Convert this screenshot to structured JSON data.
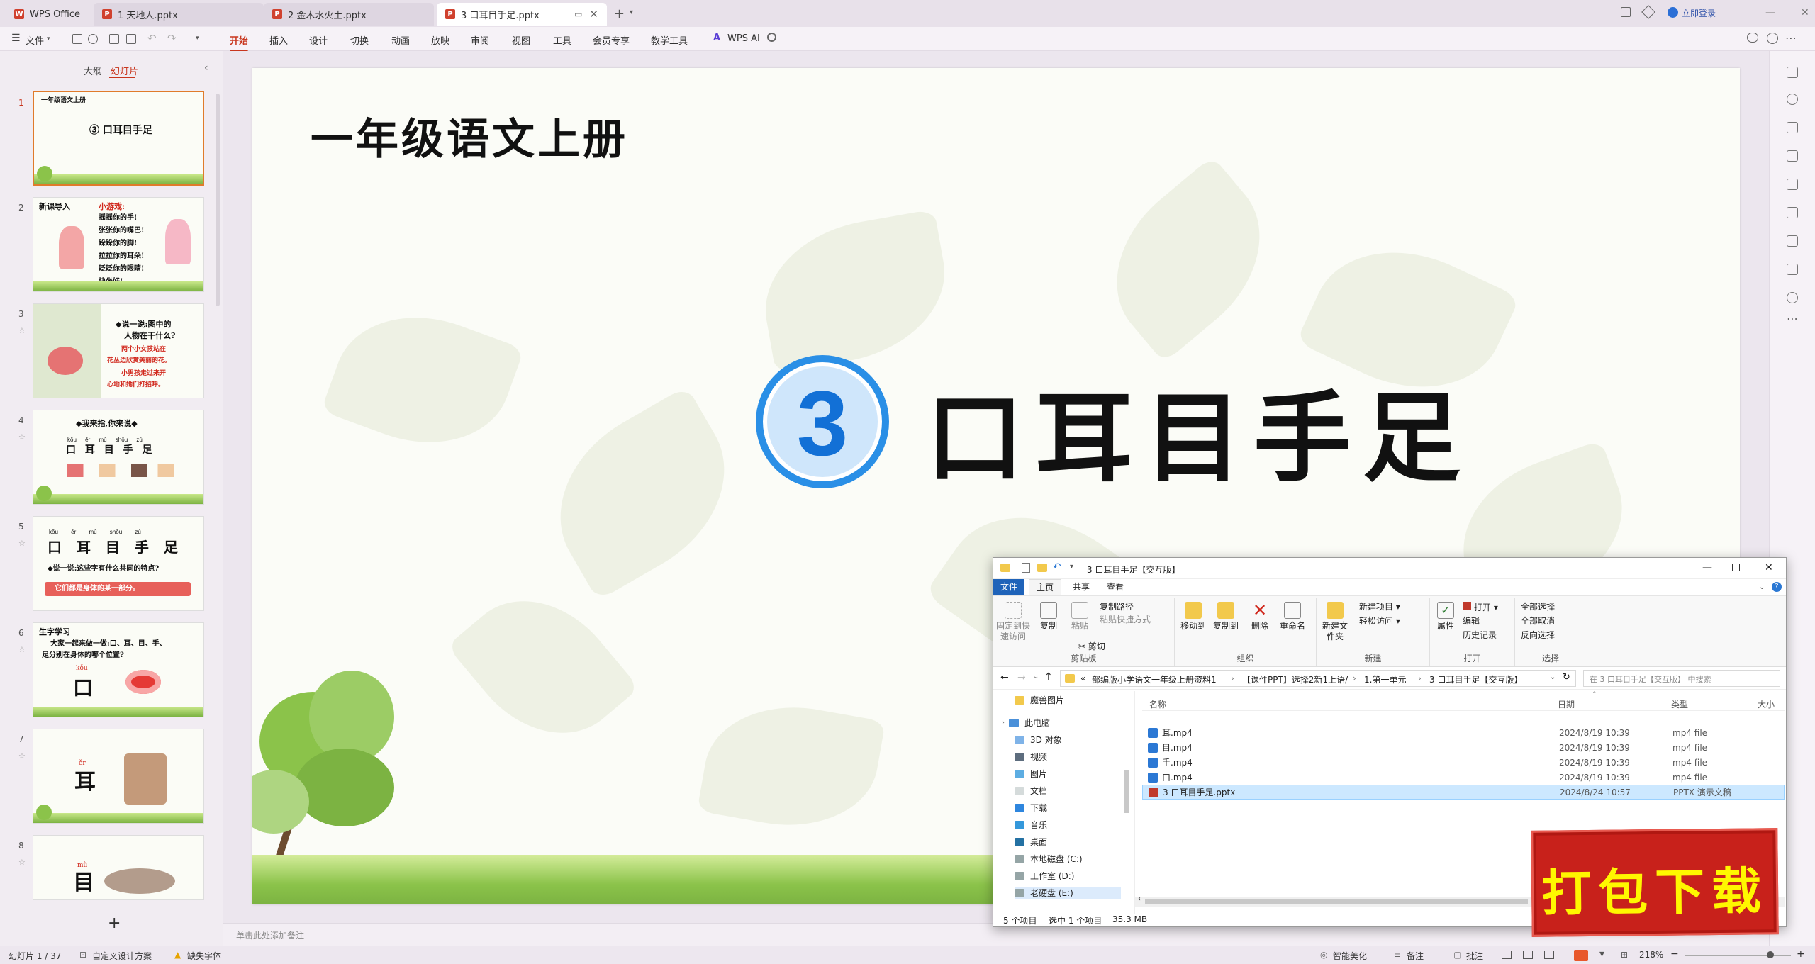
{
  "titlebar": {
    "app_tab": "WPS Office",
    "tabs": [
      {
        "label": "1 天地人.pptx"
      },
      {
        "label": "2 金木水火土.pptx"
      },
      {
        "label": "3 口耳目手足.pptx"
      }
    ],
    "login": "立即登录"
  },
  "ribbon": {
    "file": "文件",
    "tabs": [
      "开始",
      "插入",
      "设计",
      "切换",
      "动画",
      "放映",
      "审阅",
      "视图",
      "工具",
      "会员专享",
      "教学工具"
    ],
    "wps_ai": "WPS AI"
  },
  "left_panel": {
    "tab_outline": "大纲",
    "tab_slides": "幻灯片",
    "add": "+",
    "slides": [
      {
        "num": "1",
        "lines": [
          "一年级语文上册",
          "③ 口耳目手足"
        ]
      },
      {
        "num": "2",
        "lines": [
          "新课导入",
          "小游戏:",
          "摇摇你的手!",
          "张张你的嘴巴!",
          "跺跺你的脚!",
          "拉拉你的耳朵!",
          "眨眨你的眼睛!",
          "快坐好!"
        ]
      },
      {
        "num": "3",
        "lines": [
          "◆说一说:图中的",
          "人物在干什么?",
          "两个小女孩站在",
          "花丛边欣赏美丽的花。",
          "小男孩走过来开",
          "心地和她们打招呼。"
        ]
      },
      {
        "num": "4",
        "lines": [
          "◆我来指,你来说◆",
          "kǒu ěr mù shǒu zú",
          "口 耳 目 手 足"
        ]
      },
      {
        "num": "5",
        "lines": [
          "kǒu ěr mù shǒu zú",
          "口 耳 目 手 足",
          "◆说一说:这些字有什么共同的特点?",
          "它们都是身体的某一部分。"
        ]
      },
      {
        "num": "6",
        "lines": [
          "生字学习",
          "大家一起来做一做:口、耳、目、手、",
          "足分别在身体的哪个位置?",
          "kǒu",
          "口"
        ]
      },
      {
        "num": "7",
        "lines": [
          "ěr",
          "耳"
        ]
      },
      {
        "num": "8",
        "lines": [
          "mù",
          "目"
        ]
      }
    ]
  },
  "slide": {
    "title": "一年级语文上册",
    "lesson_number": "3",
    "lesson_name": "口耳目手足"
  },
  "notes_placeholder": "单击此处添加备注",
  "statusbar": {
    "slide_info": "幻灯片 1 / 37",
    "design": "自定义设计方案",
    "font": "缺失字体",
    "beautify": "智能美化",
    "notes": "备注",
    "comments": "批注",
    "zoom": "218%"
  },
  "explorer": {
    "title": "3 口耳目手足【交互版】",
    "ribbon_tabs": [
      "文件",
      "主页",
      "共享",
      "查看"
    ],
    "groups": [
      {
        "label": "剪贴板",
        "buttons": [
          "固定到快速访问",
          "复制",
          "粘贴",
          "复制路径",
          "粘贴快捷方式",
          "剪切"
        ]
      },
      {
        "label": "组织",
        "buttons": [
          "移动到",
          "复制到",
          "删除",
          "重命名"
        ]
      },
      {
        "label": "新建",
        "buttons": [
          "新建文件夹",
          "新建项目",
          "轻松访问"
        ]
      },
      {
        "label": "打开",
        "buttons": [
          "属性",
          "打开",
          "编辑",
          "历史记录"
        ]
      },
      {
        "label": "选择",
        "buttons": [
          "全部选择",
          "全部取消",
          "反向选择"
        ]
      }
    ],
    "breadcrumb": [
      "«",
      "部编版小学语文一年级上册资料1",
      "【课件PPT】选择2新1上语/",
      "1.第一单元",
      "3 口耳目手足【交互版】"
    ],
    "search_placeholder": "在 3 口耳目手足【交互版】 中搜索",
    "nav": [
      "魔兽图片",
      "此电脑",
      "3D 对象",
      "视频",
      "图片",
      "文档",
      "下载",
      "音乐",
      "桌面",
      "本地磁盘 (C:)",
      "工作室 (D:)",
      "老硬盘 (E:)"
    ],
    "columns": [
      "名称",
      "日期",
      "类型",
      "大小"
    ],
    "files": [
      {
        "name": "耳.mp4",
        "date": "2024/8/19 10:39",
        "type": "mp4 file"
      },
      {
        "name": "目.mp4",
        "date": "2024/8/19 10:39",
        "type": "mp4 file"
      },
      {
        "name": "手.mp4",
        "date": "2024/8/19 10:39",
        "type": "mp4 file"
      },
      {
        "name": "口.mp4",
        "date": "2024/8/19 10:39",
        "type": "mp4 file"
      },
      {
        "name": "3 口耳目手足.pptx",
        "date": "2024/8/24 10:57",
        "type": "PPTX 演示文稿"
      }
    ],
    "status_count": "5 个项目",
    "status_selected": "选中 1 个项目",
    "status_size": "35.3 MB"
  },
  "badge": "打包下载",
  "colors": {
    "accent": "#c8361e",
    "slide_blue": "#1270d6",
    "badge_red": "#c8211b",
    "badge_text": "#fff700"
  }
}
